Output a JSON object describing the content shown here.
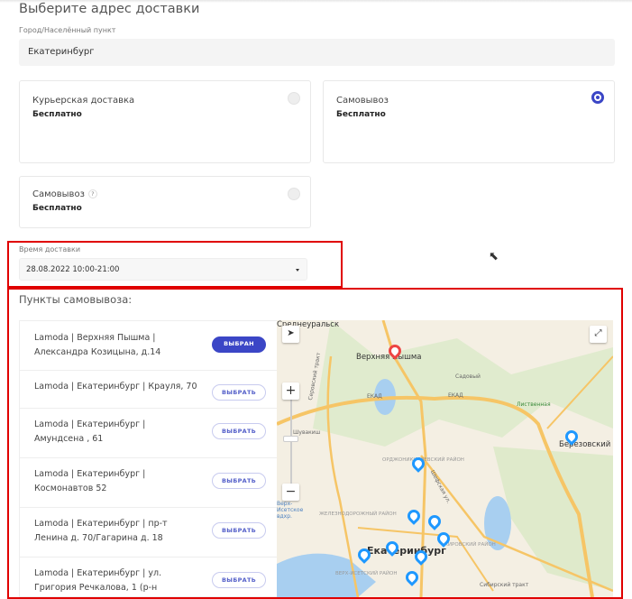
{
  "page": {
    "title": "Выберите адрес доставки",
    "city_label": "Город/Населённый пункт",
    "city_value": "Екатеринбург"
  },
  "options": [
    {
      "name": "Курьерская доставка",
      "price": "Бесплатно",
      "selected": false
    },
    {
      "name": "Самовывоз",
      "price": "Бесплатно",
      "selected": true
    },
    {
      "name": "Самовывоз",
      "price": "Бесплатно",
      "selected": false,
      "help": "?"
    }
  ],
  "delivery_time": {
    "label": "Время доставки",
    "value": "28.08.2022 10:00-21:00"
  },
  "pickup": {
    "title": "Пункты самовывоза:",
    "points": [
      {
        "text": "Lamoda | Верхняя Пышма | Александра Козицына, д.14",
        "button": "ВЫБРАН",
        "selected": true
      },
      {
        "text": "Lamoda | Екатеринбург | Крауля, 70",
        "button": "ВЫБРАТЬ",
        "selected": false
      },
      {
        "text": "Lamoda | Екатеринбург | Амундсена , 61",
        "button": "ВЫБРАТЬ",
        "selected": false
      },
      {
        "text": "Lamoda | Екатеринбург | Космонавтов 52",
        "button": "ВЫБРАТЬ",
        "selected": false
      },
      {
        "text": "Lamoda | Екатеринбург | пр-т Ленина д. 70/Гагарина д. 18",
        "button": "ВЫБРАТЬ",
        "selected": false
      },
      {
        "text": "Lamoda | Екатеринбург | ул. Григория Речкалова, 1 (р-н",
        "button": "ВЫБРАТЬ",
        "selected": false
      }
    ]
  },
  "map": {
    "labels": {
      "sredneuralsk": "Среднеуральск",
      "vp": "Верхняя Пышма",
      "sadovy": "Садовый",
      "ekad": "ЕКАД",
      "shuvakish": "Шувакиш",
      "berezovsky": "Березовский",
      "ekb": "Екатеринбург",
      "listvennaya": "Лиственная",
      "ordzh": "ОРДЖОНИКИДЗЕВСКИЙ РАЙОН",
      "zhd": "ЖЕЛЕЗНОДОРОЖНЫЙ РАЙОН",
      "vi": "ВЕРХ-ИСЕТСКИЙ РАЙОН",
      "vdhr": "Верх-Исетское вдхр.",
      "shefskaya": "Шефская ул.",
      "sibtrakt": "Сибирский тракт",
      "serovtrakt": "Серовский тракт",
      "kirov": "КИРОВСКИЙ РАЙОН"
    },
    "zoom_in": "+",
    "zoom_out": "−"
  }
}
